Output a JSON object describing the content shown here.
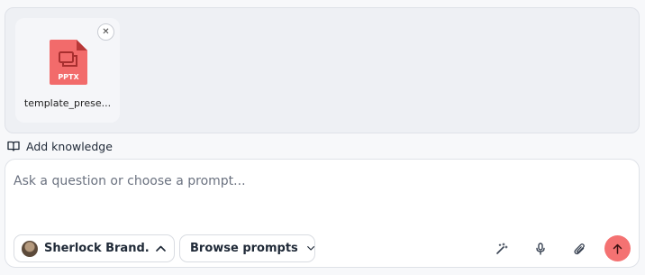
{
  "attachments": [
    {
      "file_name": "template_prese...",
      "file_type_label": "PPTX",
      "icon": "pptx-file-icon",
      "color": "#f26b6b"
    }
  ],
  "knowledge": {
    "label": "Add knowledge",
    "icon": "book-icon"
  },
  "composer": {
    "placeholder": "Ask a question or choose a prompt...",
    "value": "",
    "agent": {
      "name": "Sherlock Brand...",
      "icon": "chevron-up-icon"
    },
    "browse_prompts_label": "Browse prompts",
    "tools": [
      "magic-wand-icon",
      "microphone-icon",
      "paperclip-icon"
    ],
    "send": {
      "icon": "arrow-up-icon",
      "color": "#f47272"
    }
  },
  "colors": {
    "accent": "#f47272",
    "file_icon": "#f26b6b"
  }
}
